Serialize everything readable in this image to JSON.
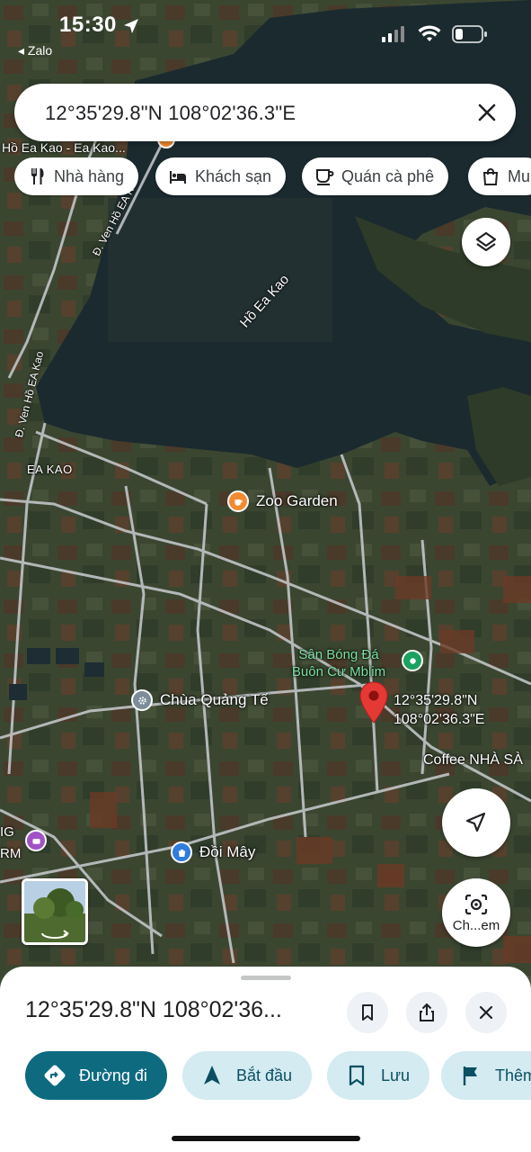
{
  "status_bar": {
    "time": "15:30",
    "back_app": "◂ Zalo"
  },
  "search": {
    "query": "12°35'29.8\"N 108°02'36.3\"E"
  },
  "chips": [
    {
      "label": "Nhà hàng",
      "icon": "restaurant-icon"
    },
    {
      "label": "Khách sạn",
      "icon": "hotel-icon"
    },
    {
      "label": "Quán cà phê",
      "icon": "coffee-icon"
    },
    {
      "label": "Mu",
      "icon": "shopping-bag-icon"
    }
  ],
  "map": {
    "labels": {
      "ho_ea_kao_top": "Hồ Ea Kao - Ea Kao...",
      "road_ven_ho_top": "Đ. Ven Hồ EA K",
      "lake": "Hồ Ea Kao",
      "road_ven_ho_left": "Đ. Ven Hồ EA Kao",
      "area": "EA KAO",
      "coffee_label": "Coffee NHÀ SÀ",
      "left_edge_top": "IG",
      "left_edge_bottom": "RM"
    },
    "pois": {
      "zoo_garden": "Zoo Garden",
      "stadium": "Sân Bóng Đá Buôn Cư Mblim",
      "pagoda": "Chùa Quảng Tế",
      "doi_may": "Đồi Mây"
    },
    "pin_label": [
      "12°35'29.8\"N",
      "108°02'36.3\"E"
    ],
    "lens_label": "Ch...em",
    "colors": {
      "water": "#1c2a30",
      "land": "#3a4630",
      "road": "#c8ccd0",
      "pin": "#e53935",
      "poi_orange": "#f28b30",
      "poi_green": "#1aa260",
      "poi_blue": "#2f7ddc",
      "poi_gray": "#7c8c99",
      "poi_purple": "#a152c4"
    }
  },
  "sheet": {
    "title": "12°35'29.8\"N 108°02'36...",
    "actions": [
      {
        "label": "Đường đi",
        "icon": "directions-icon"
      },
      {
        "label": "Bắt đầu",
        "icon": "navigation-arrow-icon"
      },
      {
        "label": "Lưu",
        "icon": "bookmark-icon"
      },
      {
        "label": "Thêm",
        "icon": "flag-icon"
      }
    ],
    "colors": {
      "primary": "#0d6a7f",
      "secondary": "#d3ebf1"
    }
  }
}
